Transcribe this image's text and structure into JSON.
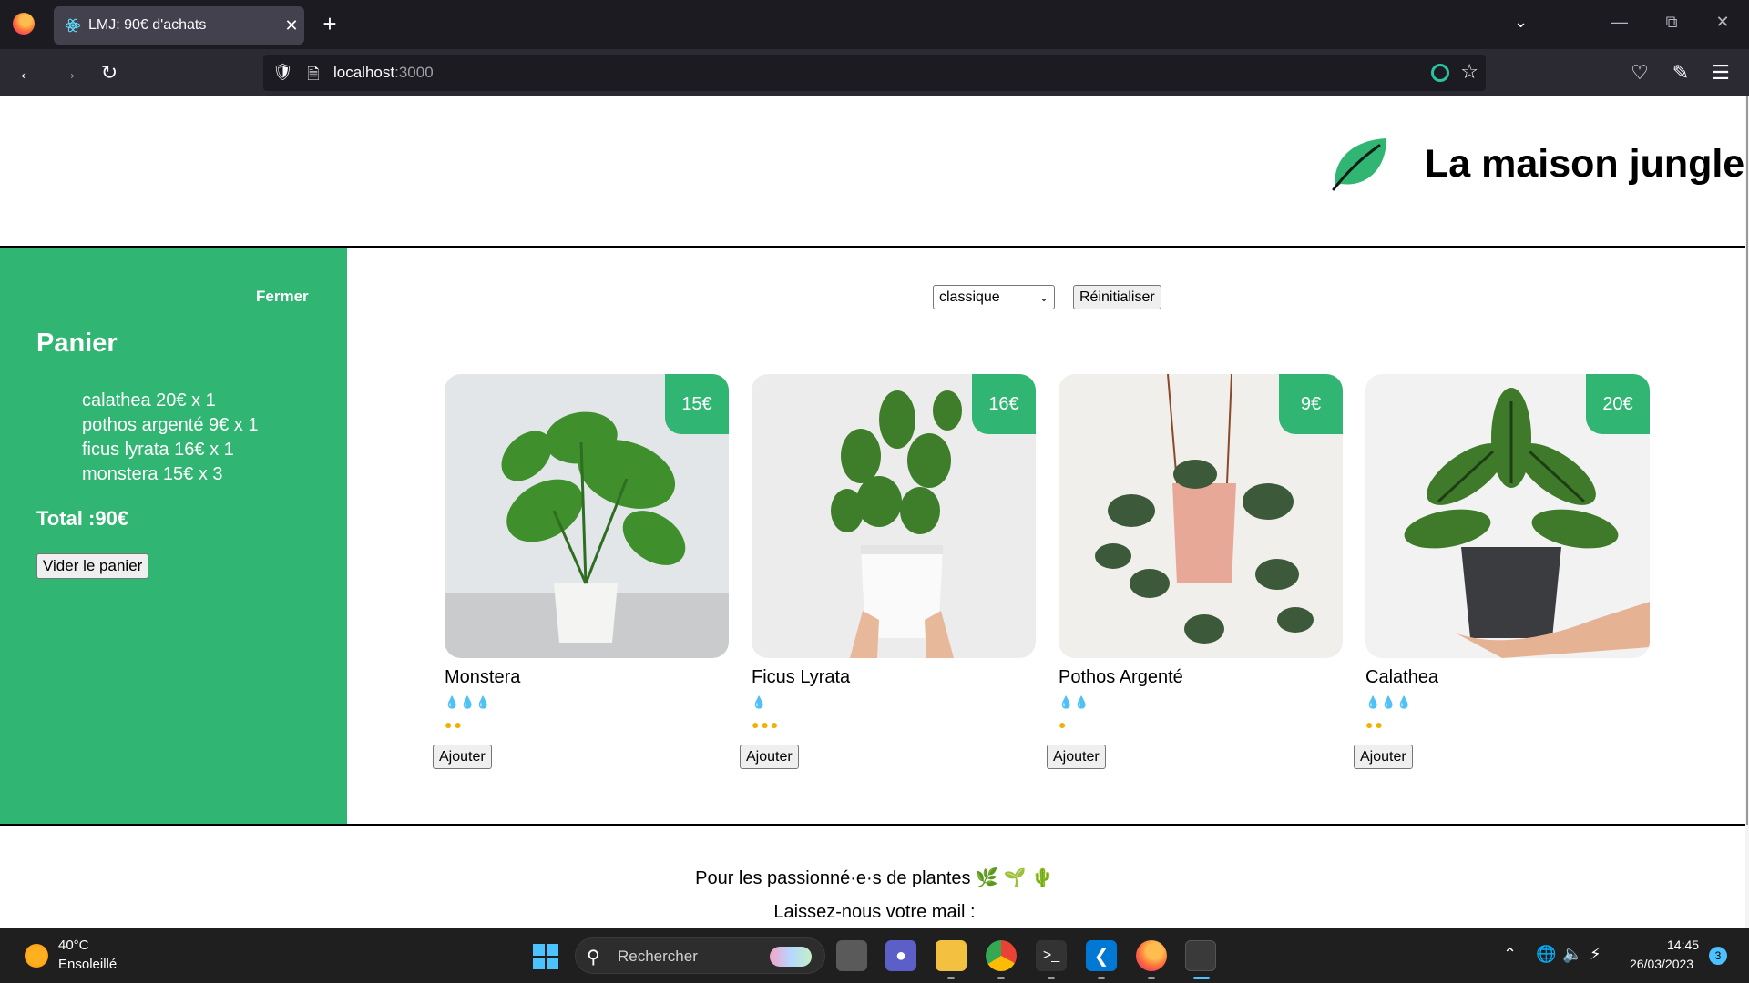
{
  "browser": {
    "tab_title": "LMJ: 90€ d'achats",
    "tab_close": "✕",
    "new_tab": "+",
    "url_host": "localhost",
    "url_port": ":3000"
  },
  "site": {
    "title": "La maison jungle",
    "accent_color": "#31b572"
  },
  "cart": {
    "close_label": "Fermer",
    "title": "Panier",
    "items": [
      "calathea 20€ x 1",
      "pothos argenté 9€ x 1",
      "ficus lyrata 16€ x 1",
      "monstera 15€ x 3"
    ],
    "total": "Total :90€",
    "empty_button": "Vider le panier"
  },
  "filters": {
    "selected_category": "classique",
    "reset_button": "Réinitialiser"
  },
  "plants": [
    {
      "name": "Monstera",
      "price": "15€",
      "water": 3,
      "light": 2,
      "add_label": "Ajouter"
    },
    {
      "name": "Ficus Lyrata",
      "price": "16€",
      "water": 1,
      "light": 3,
      "add_label": "Ajouter"
    },
    {
      "name": "Pothos Argenté",
      "price": "9€",
      "water": 2,
      "light": 1,
      "add_label": "Ajouter"
    },
    {
      "name": "Calathea",
      "price": "20€",
      "water": 3,
      "light": 2,
      "add_label": "Ajouter"
    }
  ],
  "footer": {
    "tagline": "Pour les passionné·e·s de plantes 🌿 🌱 🌵",
    "mail_prompt": "Laissez-nous votre mail :"
  },
  "taskbar": {
    "weather_temp": "40°C",
    "weather_desc": "Ensoleillé",
    "search_placeholder": "Rechercher",
    "time": "14:45",
    "date": "26/03/2023",
    "notification_count": "3"
  }
}
